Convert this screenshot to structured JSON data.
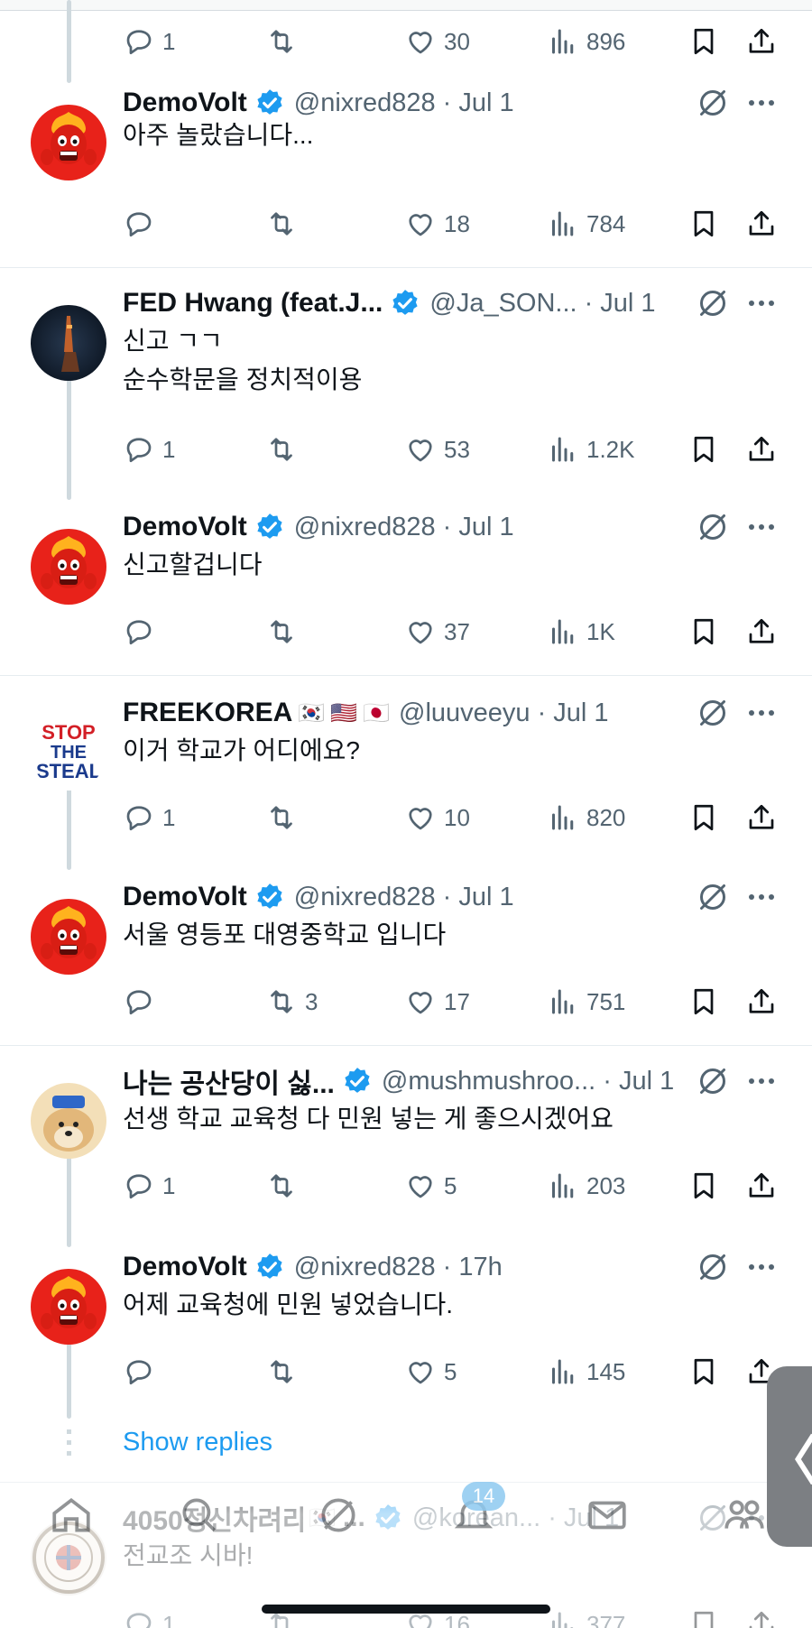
{
  "partial_actions": {
    "reply": "1",
    "retweet": "",
    "like": "30",
    "views": "896"
  },
  "tweets": [
    {
      "name": "DemoVolt",
      "handle": "@nixred828",
      "time": "· Jul 1",
      "text": [
        "아주 놀랐습니다..."
      ],
      "reply": "",
      "retweet": "",
      "like": "18",
      "views": "784"
    },
    {
      "name": "FED Hwang (feat.J...",
      "handle": "@Ja_SON...",
      "time": "· Jul 1",
      "text": [
        "신고 ㄱㄱ",
        "순수학문을 정치적이용"
      ],
      "reply": "1",
      "retweet": "",
      "like": "53",
      "views": "1.2K"
    },
    {
      "name": "DemoVolt",
      "handle": "@nixred828",
      "time": "· Jul 1",
      "text": [
        "신고할겁니다"
      ],
      "reply": "",
      "retweet": "",
      "like": "37",
      "views": "1K"
    },
    {
      "name": "FREEKOREA",
      "flags": [
        "🇰🇷",
        "🇺🇸",
        "🇯🇵"
      ],
      "handle": "@luuveeyu",
      "time": "· Jul 1",
      "text": [
        "이거 학교가 어디에요?"
      ],
      "reply": "1",
      "retweet": "",
      "like": "10",
      "views": "820"
    },
    {
      "name": "DemoVolt",
      "handle": "@nixred828",
      "time": "· Jul 1",
      "text": [
        "서울 영등포 대영중학교 입니다"
      ],
      "reply": "",
      "retweet": "3",
      "like": "17",
      "views": "751"
    },
    {
      "name": "나는 공산당이 싫...",
      "handle": "@mushmushroo...",
      "time": "· Jul 1",
      "text": [
        "선생 학교 교육청 다 민원 넣는 게 좋으시겠어요"
      ],
      "reply": "1",
      "retweet": "",
      "like": "5",
      "views": "203"
    },
    {
      "name": "DemoVolt",
      "handle": "@nixred828",
      "time": "· 17h",
      "text": [
        "어제 교육청에 민원 넣었습니다."
      ],
      "reply": "",
      "retweet": "",
      "like": "5",
      "views": "145"
    },
    {
      "name": "4050정신차려라!",
      "flags": [
        "🇰🇷"
      ],
      "name_suffix": "...",
      "handle": "@korean...",
      "time": "· Jul 1",
      "text": [
        "전교조 시바!"
      ],
      "reply": "1",
      "retweet": "",
      "like": "16",
      "views": "377"
    }
  ],
  "show_replies": "Show replies",
  "avatar_text": {
    "stop_the_steal": [
      "STOP",
      "THE",
      "STEAL"
    ]
  },
  "nav": {
    "notif_count": "14"
  },
  "side_tab": "〈",
  "colors": {
    "accent": "#1d9bf0",
    "text_secondary": "#536471",
    "thread_line": "#cfd9de"
  },
  "icons": [
    "reply-icon",
    "retweet-icon",
    "like-icon",
    "views-icon",
    "bookmark-icon",
    "share-icon",
    "verified-badge-icon",
    "grok-icon",
    "more-icon"
  ]
}
